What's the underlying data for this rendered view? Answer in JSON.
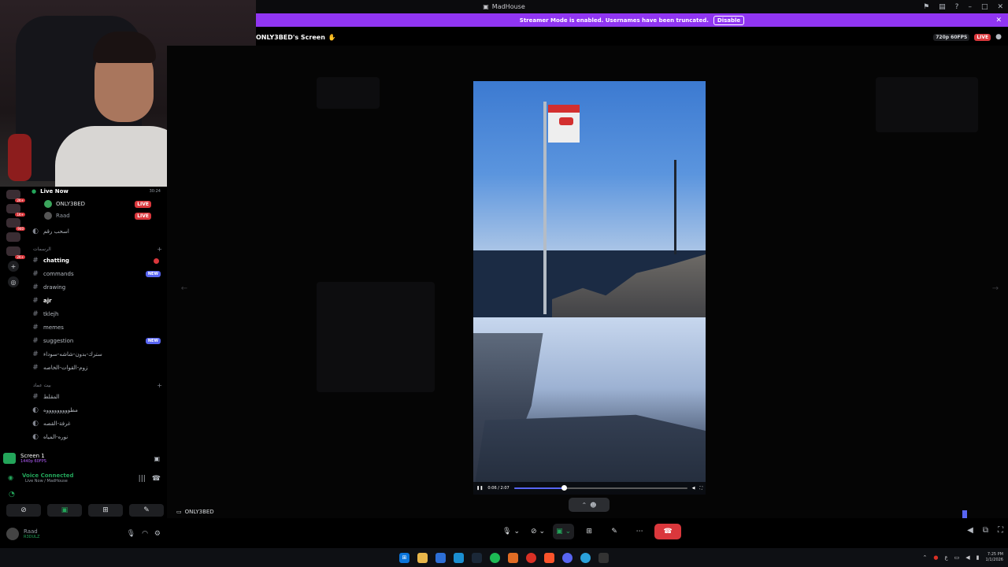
{
  "window": {
    "title": "MadHouse"
  },
  "banner": {
    "text": "Streamer Mode is enabled. Usernames have been truncated.",
    "disable_label": "Disable",
    "close": "✕"
  },
  "stream": {
    "title": "ONLY3BED's Screen",
    "quality": "720p 60FPS",
    "live_badge": "LIVE",
    "streamer_label": "ONLY3BED"
  },
  "sidebar": {
    "live_now": "Live Now",
    "live_timer": "30:24",
    "voice_users": [
      {
        "name": "ONLY3BED",
        "badge": "LIVE"
      },
      {
        "name": "Raad",
        "badge": "LIVE"
      }
    ],
    "top_channel": "اسحب رقم",
    "category1": "الرسمات",
    "channels": [
      {
        "icon": "💬",
        "name": "chatting",
        "marker": "dot"
      },
      {
        "icon": "",
        "name": "commands",
        "marker": "NEW"
      },
      {
        "icon": "",
        "name": "drawing",
        "marker": ""
      },
      {
        "icon": "",
        "name": "ajr",
        "marker": ""
      },
      {
        "icon": "",
        "name": "tklejh",
        "marker": ""
      },
      {
        "icon": "",
        "name": "memes",
        "marker": ""
      },
      {
        "icon": "",
        "name": "suggestion",
        "marker": "NEW"
      },
      {
        "icon": "",
        "name": "سترك-بدون-شاشه-سوداء",
        "marker": ""
      },
      {
        "icon": "",
        "name": "زوم-القوات-الخاصه",
        "marker": ""
      }
    ],
    "category2": "بيت عماد",
    "voice_channels": [
      {
        "name": "المقلط"
      },
      {
        "name": "مطوووووووووه"
      },
      {
        "name": "غرفة-القصه"
      },
      {
        "name": "نوره-المياه"
      }
    ],
    "server_counts": [
      "2K+",
      "1K+",
      "940",
      "2K+"
    ]
  },
  "screen_panel": {
    "title": "Screen 1",
    "sub": "1440p 60FPS"
  },
  "voice_connected": {
    "label": "Voice Connected",
    "where": "Live Now / MadHouse"
  },
  "user": {
    "name": "Raad",
    "status": "R3DULZ"
  },
  "video": {
    "time": "0:06 / 2:07",
    "progress_fraction": 0.29
  },
  "taskbar": {
    "time": "7:25 PM",
    "date": "1/1/2026"
  }
}
